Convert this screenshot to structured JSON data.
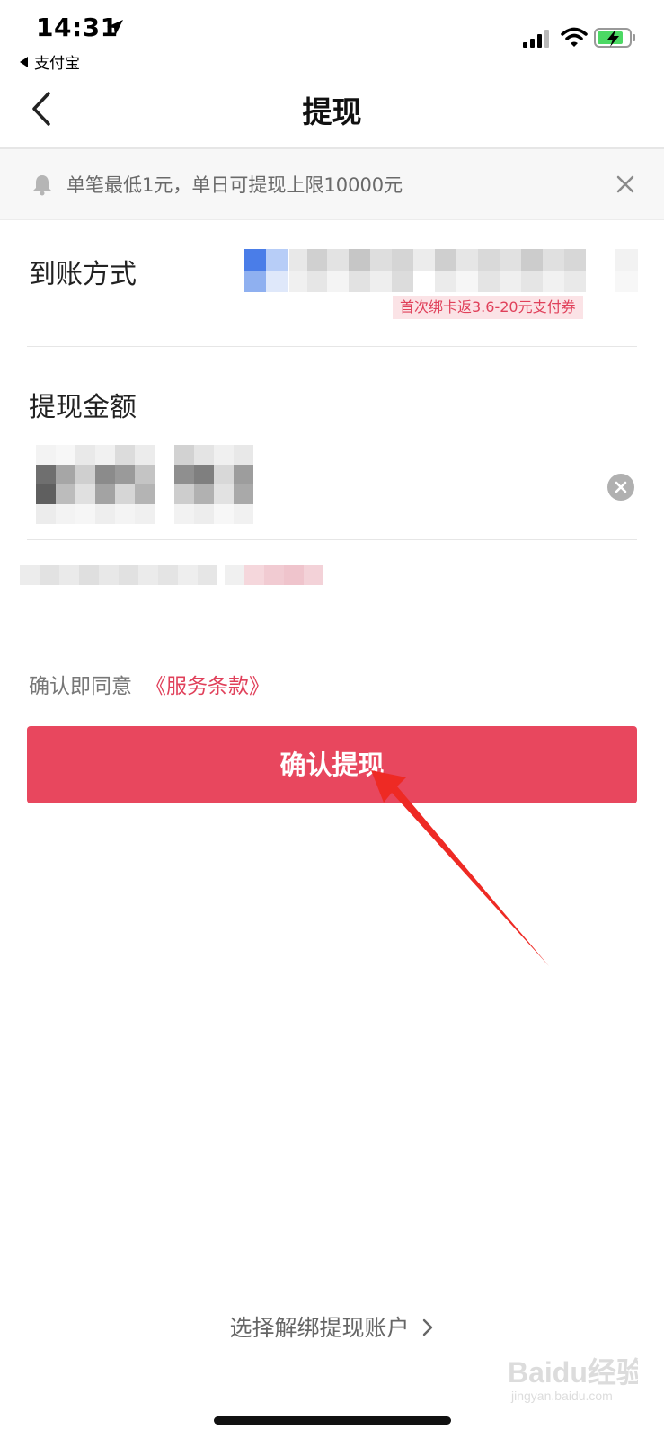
{
  "status_bar": {
    "time": "14:31",
    "back_app": "支付宝"
  },
  "nav": {
    "title": "提现"
  },
  "notice": {
    "text": "单笔最低1元，单日可提现上限10000元"
  },
  "arrival_method": {
    "label": "到账方式",
    "coupon_tag": "首次绑卡返3.6-20元支付券"
  },
  "amount": {
    "label": "提现金额"
  },
  "terms": {
    "prefix": "确认即同意",
    "link": "《服务条款》"
  },
  "confirm_button": "确认提现",
  "unbind_link": "选择解绑提现账户",
  "watermark": {
    "brand": "Baidu经验",
    "url": "jingyan.baidu.com"
  },
  "colors": {
    "accent": "#e8475e",
    "link": "#e0405a"
  }
}
